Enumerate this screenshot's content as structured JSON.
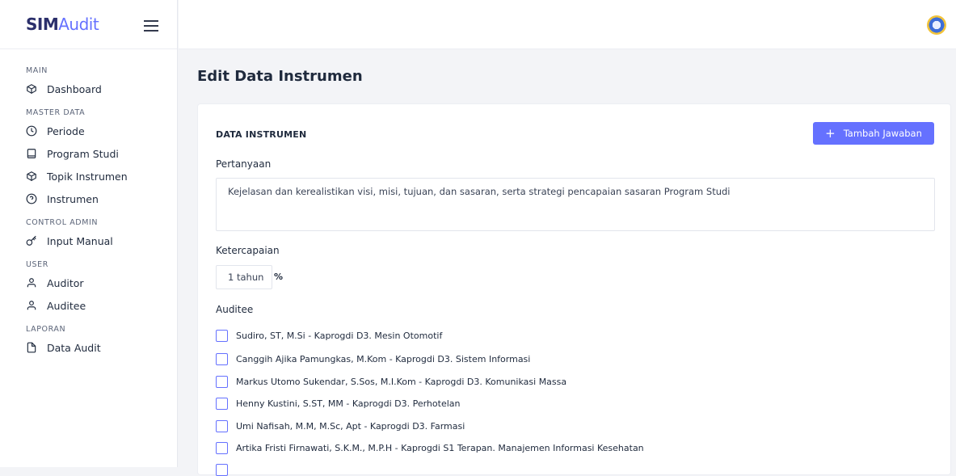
{
  "brand": {
    "part1": "SIM",
    "part2": "Audit"
  },
  "sidebar": {
    "sections": [
      {
        "title": "MAIN",
        "items": [
          {
            "label": "Dashboard",
            "icon": "box-icon"
          }
        ]
      },
      {
        "title": "MASTER DATA",
        "items": [
          {
            "label": "Periode",
            "icon": "clock-icon"
          },
          {
            "label": "Program Studi",
            "icon": "tablet-icon"
          },
          {
            "label": "Topik Instrumen",
            "icon": "box-icon"
          },
          {
            "label": "Instrumen",
            "icon": "help-circle-icon"
          }
        ]
      },
      {
        "title": "CONTROL ADMIN",
        "items": [
          {
            "label": "Input Manual",
            "icon": "key-icon"
          }
        ]
      },
      {
        "title": "USER",
        "items": [
          {
            "label": "Auditor",
            "icon": "user-icon"
          },
          {
            "label": "Auditee",
            "icon": "user-icon"
          }
        ]
      },
      {
        "title": "LAPORAN",
        "items": [
          {
            "label": "Data Audit",
            "icon": "file-icon"
          }
        ]
      }
    ]
  },
  "page": {
    "title": "Edit Data Instrumen"
  },
  "card": {
    "heading": "DATA INSTRUMEN",
    "add_button": "Tambah Jawaban",
    "pertanyaan_label": "Pertanyaan",
    "pertanyaan_value": "Kejelasan dan kerealistikan visi, misi, tujuan, dan sasaran, serta strategi pencapaian sasaran Program Studi",
    "ketercapaian_label": "Ketercapaian",
    "ketercapaian_value": "1 tahun",
    "percent": "%",
    "auditee_label": "Auditee",
    "auditees": [
      "Sudiro, ST, M.Si - Kaprogdi D3. Mesin Otomotif",
      "Canggih Ajika Pamungkas, M.Kom - Kaprogdi D3. Sistem Informasi",
      "Markus Utomo Sukendar, S.Sos, M.I.Kom - Kaprogdi D3. Komunikasi Massa",
      "Henny Kustini, S.ST, MM - Kaprogdi D3. Perhotelan",
      "Umi Nafisah, M.M, M.Sc, Apt - Kaprogdi D3. Farmasi",
      "Artika Fristi Firnawati, S.K.M., M.P.H - Kaprogdi S1 Terapan. Manajemen Informasi Kesehatan"
    ]
  },
  "colors": {
    "accent": "#6571ff",
    "brand_dark": "#2b2f6b"
  }
}
